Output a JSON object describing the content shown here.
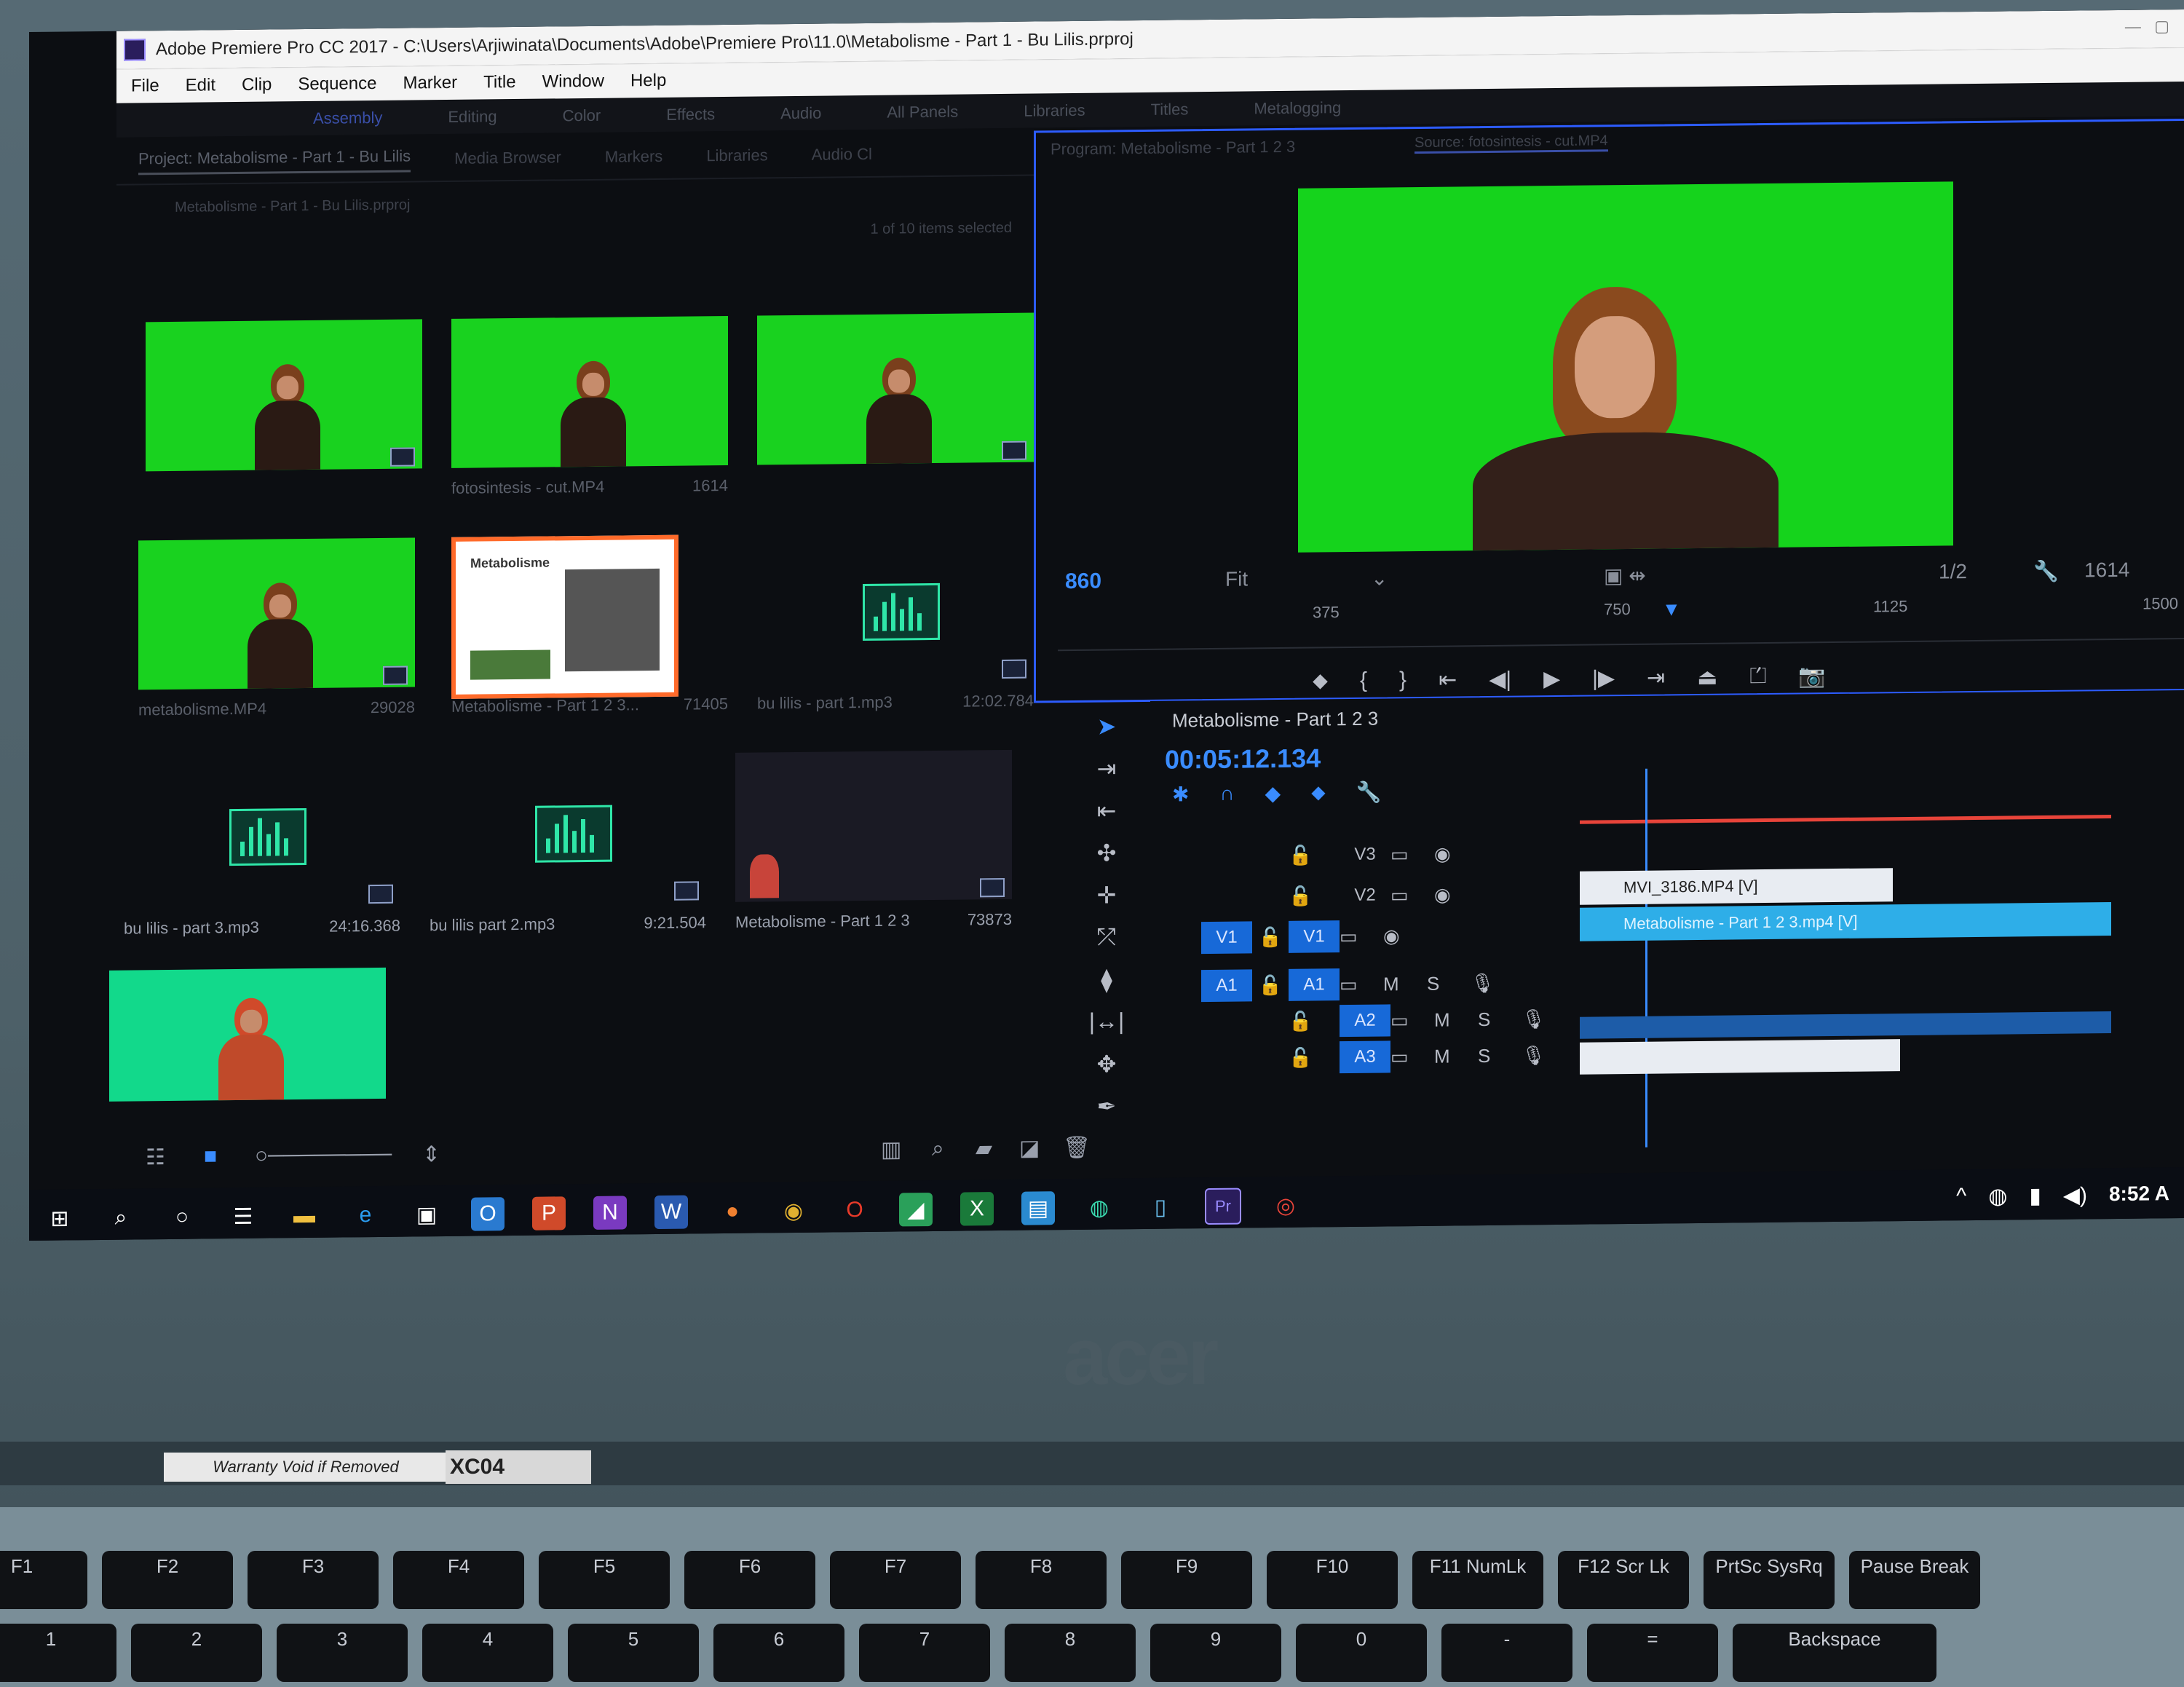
{
  "window": {
    "title": "Adobe Premiere Pro CC 2017 - C:\\Users\\Arjiwinata\\Documents\\Adobe\\Premiere Pro\\11.0\\Metabolisme - Part 1 - Bu Lilis.prproj"
  },
  "menu": [
    "File",
    "Edit",
    "Clip",
    "Sequence",
    "Marker",
    "Title",
    "Window",
    "Help"
  ],
  "workspaces": [
    "Assembly",
    "Editing",
    "Color",
    "Effects",
    "Audio",
    "All Panels",
    "Libraries",
    "Titles",
    "Metalogging"
  ],
  "project": {
    "tabs": [
      "Project: Metabolisme - Part 1 - Bu Lilis",
      "Media Browser",
      "Markers",
      "Libraries",
      "Audio Cl"
    ],
    "path": "Metabolisme - Part 1 - Bu Lilis.prproj",
    "selection": "1 of 10 items selected",
    "items": [
      {
        "name": "",
        "duration": "",
        "type": "video"
      },
      {
        "name": "fotosintesis - cut.MP4",
        "duration": "1614",
        "type": "video"
      },
      {
        "name": "",
        "duration": "",
        "type": "video"
      },
      {
        "name": "metabolisme.MP4",
        "duration": "29028",
        "type": "video"
      },
      {
        "name": "Metabolisme - Part 1 2 3...",
        "duration": "71405",
        "type": "sequence"
      },
      {
        "name": "bu lilis - part 1.mp3",
        "duration": "12:02.784",
        "type": "audio"
      },
      {
        "name": "bu lilis - part 3.mp3",
        "duration": "24:16.368",
        "type": "audio"
      },
      {
        "name": "bu lilis part 2.mp3",
        "duration": "9:21.504",
        "type": "audio"
      },
      {
        "name": "Metabolisme - Part 1 2 3",
        "duration": "73873",
        "type": "sequence"
      },
      {
        "name": "",
        "duration": "",
        "type": "video"
      }
    ],
    "seq_thumb_title": "Metabolisme"
  },
  "program": {
    "title": "Program: Metabolisme - Part 1 2 3",
    "source_tab": "Source: fotosintesis - cut.MP4",
    "in_frame": "860",
    "zoom": "Fit",
    "resolution": "1/2",
    "out_frame": "1614",
    "ruler": [
      "375",
      "750",
      "1125",
      "1500"
    ]
  },
  "timeline": {
    "sequence_name": "Metabolisme - Part 1 2 3",
    "timecode": "00:05:12.134",
    "video_tracks": [
      "V3",
      "V2",
      "V1"
    ],
    "audio_tracks": [
      "A1",
      "A2",
      "A3"
    ],
    "source_v": "V1",
    "source_a": "A1",
    "clips": {
      "v2": "MVI_3186.MP4 [V]",
      "v1": "Metabolisme - Part 1 2 3.mp4 [V]"
    },
    "m_label": "M",
    "s_label": "S"
  },
  "taskbar": {
    "clock": "8:52 A"
  },
  "laptop": {
    "brand": "acer",
    "warranty": "Warranty Void if Removed",
    "sticker": "XC04"
  },
  "keys": [
    "F1",
    "F2",
    "F3",
    "F4",
    "F5",
    "F6",
    "F7",
    "F8",
    "F9",
    "F10",
    "F11 NumLk",
    "F12 Scr Lk",
    "PrtSc SysRq",
    "Pause Break"
  ],
  "keys2": [
    "1",
    "2",
    "3",
    "4",
    "5",
    "6",
    "7",
    "8",
    "9",
    "0",
    "-",
    "=",
    "Backspace"
  ],
  "colors": {
    "accent": "#2d5cff",
    "greenscreen": "#19d21f",
    "workbar": "#e8443a",
    "clip": "#2eaee8"
  }
}
